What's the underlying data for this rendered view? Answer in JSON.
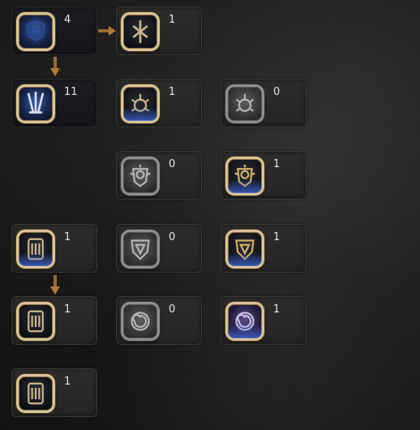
{
  "skill_tree": {
    "nodes": [
      {
        "id": "n1",
        "count": "4",
        "icon": "seal-glyph-icon",
        "state": "active"
      },
      {
        "id": "n2",
        "count": "1",
        "icon": "rune-glyph-icon",
        "state": "active"
      },
      {
        "id": "n3",
        "count": "11",
        "icon": "claw-glyph-icon",
        "state": "active"
      },
      {
        "id": "n4",
        "count": "1",
        "icon": "bug-emblem-icon",
        "state": "learned"
      },
      {
        "id": "n5",
        "count": "0",
        "icon": "bug-emblem-icon",
        "state": "locked"
      },
      {
        "id": "n6",
        "count": "0",
        "icon": "sun-shield-icon",
        "state": "locked"
      },
      {
        "id": "n7",
        "count": "1",
        "icon": "sun-shield-icon",
        "state": "learned"
      },
      {
        "id": "n8",
        "count": "1",
        "icon": "tablet-icon",
        "state": "learned"
      },
      {
        "id": "n9",
        "count": "0",
        "icon": "crest-shield-icon",
        "state": "locked"
      },
      {
        "id": "n10",
        "count": "1",
        "icon": "crest-shield-icon",
        "state": "learned"
      },
      {
        "id": "n11",
        "count": "1",
        "icon": "tablet-icon",
        "state": "learned"
      },
      {
        "id": "n12",
        "count": "0",
        "icon": "spiral-emblem-icon",
        "state": "locked"
      },
      {
        "id": "n13",
        "count": "1",
        "icon": "spiral-emblem-icon",
        "state": "learned"
      },
      {
        "id": "n14",
        "count": "1",
        "icon": "tablet-icon",
        "state": "learned"
      }
    ]
  },
  "colors": {
    "frame_gold": "#d8c59a",
    "frame_gray": "#8f8f8f",
    "glow_blue": "#4a6ee6",
    "arrow": "#b07a3a"
  }
}
